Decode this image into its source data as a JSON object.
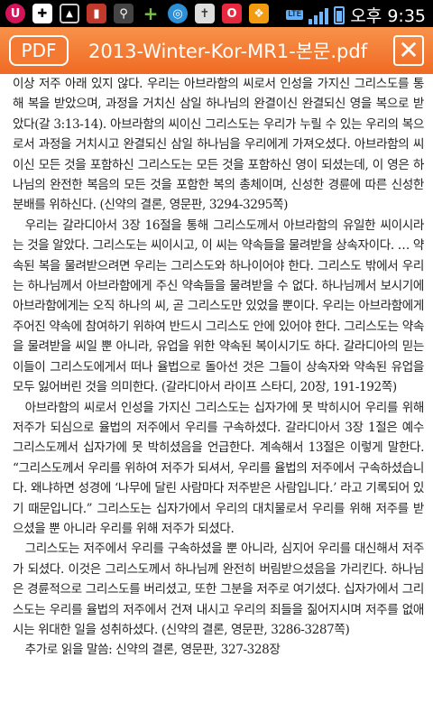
{
  "statusbar": {
    "time": "오후 9:35",
    "network": "LTE",
    "icons": [
      "u-plus-icon",
      "add-icon",
      "gallery-icon",
      "book-icon",
      "usb-icon",
      "plus-icon",
      "globe-icon",
      "bible-icon",
      "o-app-icon",
      "gift-icon"
    ]
  },
  "header": {
    "badge": "PDF",
    "title": "2013-Winter-Kor-MR1-본문.pdf",
    "close": "✕"
  },
  "paragraphs": [
    "이상 저주 아래 있지 않다. 우리는 아브라함의 씨로서 인성을 가지신 그리스도를 통해 복을 받았으며, 과정을 거치신 삼일 하나님의 완결이신 완결되신 영을 복으로 받았다(갈 3:13-14). 아브라함의 씨이신 그리스도는 우리가 누릴 수 있는 우리의 복으로서 과정을 거치시고 완결되신 삼일 하나님을 우리에게 가져오셨다. 아브라함의 씨이신 모든 것을 포함하신 그리스도는 모든 것을 포함하신 영이 되셨는데, 이 영은 하나님의 완전한 복음의 모든 것을 포함한 복의 총체이며, 신성한 경륜에 따른 신성한 분배를 위하신다. (신약의 결론, 영문판, 3294-3295쪽)",
    "우리는 갈라디아서 3장 16절을 통해 그리스도께서 아브라함의 유일한 씨이시라는 것을 알았다. 그리스도는 씨이시고, 이 씨는 약속들을 물려받을 상속자이다. … 약속된 복을 물려받으려면 우리는 그리스도와 하나이어야 한다. 그리스도 밖에서 우리는 하나님께서 아브라함에게 주신 약속들을 물려받을 수 없다. 하나님께서 보시기에 아브라함에게는 오직 하나의 씨, 곧 그리스도만 있었을 뿐이다. 우리는 아브라함에게 주어진 약속에 참여하기 위하여 반드시 그리스도 안에 있어야 한다. 그리스도는 약속을 물려받을 씨일 뿐 아니라, 유업을 위한 약속된 복이시기도 하다. 갈라디아의 믿는 이들이 그리스도에게서 떠나 율법으로 돌아선 것은 그들이 상속자와 약속된 유업을 모두 잃어버린 것을 의미한다. (갈라디아서 라이프 스타디, 20장, 191-192쪽)",
    "아브라함의 씨로서 인성을 가지신 그리스도는 십자가에 못 박히시어 우리를 위해 저주가 되심으로 율법의 저주에서 우리를 구속하셨다. 갈라디아서 3장 1절은 예수 그리스도께서 십자가에 못 박히셨음을 언급한다. 계속해서 13절은 이렇게 말한다. “그리스도께서 우리를 위하여 저주가 되셔서, 우리를 율법의 저주에서 구속하셨습니다. 왜냐하면 성경에 ‘나무에 달린 사람마다 저주받은 사람입니다.’ 라고 기록되어 있기 때문입니다.” 그리스도는 십자가에서 우리의 대치물로서 우리를 위해 저주를 받으셨을 뿐 아니라 우리를 위해 저주가 되셨다.",
    "그리스도는 저주에서 우리를 구속하셨을 뿐 아니라, 심지어 우리를 대신해서 저주가 되셨다. 이것은 그리스도께서 하나님께 완전히 버림받으셨음을 가리킨다. 하나님은 경륜적으로 그리스도를 버리셨고, 또한 그분을 저주로 여기셨다. 십자가에서 그리스도는 우리를 율법의 저주에서 건져 내시고 우리의 죄들을 짊어지시며 저주를 없애시는 위대한 일을 성취하셨다. (신약의 결론, 영문판, 3286-3287쪽)",
    "추가로 읽을 말씀: 신약의 결론, 영문판, 327-328장"
  ]
}
